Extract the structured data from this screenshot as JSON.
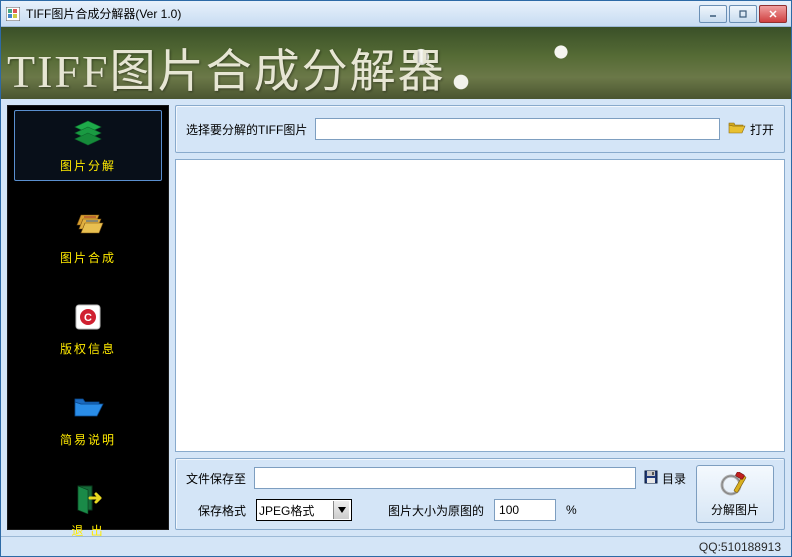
{
  "window": {
    "title": "TIFF图片合成分解器(Ver 1.0)"
  },
  "banner": {
    "title": "TIFF图片合成分解器"
  },
  "sidebar": {
    "items": [
      {
        "label": "图片分解"
      },
      {
        "label": "图片合成"
      },
      {
        "label": "版权信息"
      },
      {
        "label": "简易说明"
      },
      {
        "label": "退 出"
      }
    ]
  },
  "top": {
    "label": "选择要分解的TIFF图片",
    "path": "",
    "open_label": "打开"
  },
  "bottom": {
    "save_to_label": "文件保存至",
    "save_to_path": "",
    "dir_label": "目录",
    "format_label": "保存格式",
    "format_value": "JPEG格式",
    "size_label": "图片大小为原图的",
    "size_value": "100",
    "percent": "%"
  },
  "action": {
    "split_label": "分解图片"
  },
  "status": {
    "qq": "QQ:510188913"
  }
}
